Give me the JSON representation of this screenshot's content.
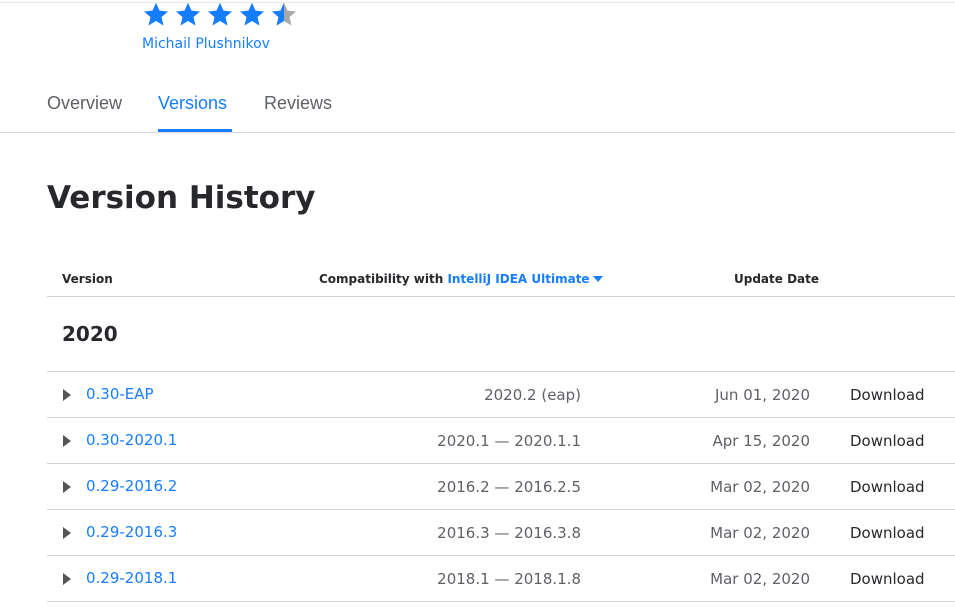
{
  "plugin": {
    "rating": 4.5,
    "rating_max": 5,
    "author": "Michail Plushnikov"
  },
  "tabs": [
    {
      "label": "Overview",
      "active": false
    },
    {
      "label": "Versions",
      "active": true
    },
    {
      "label": "Reviews",
      "active": false
    }
  ],
  "page_title": "Version History",
  "table": {
    "headers": {
      "version": "Version",
      "compat_prefix": "Compatibility with",
      "compat_product": "IntelliJ IDEA Ultimate",
      "update_date": "Update Date"
    },
    "group_year": "2020",
    "rows": [
      {
        "version": "0.30-EAP",
        "compat": "2020.2 (eap)",
        "date": "Jun 01, 2020",
        "action": "Download"
      },
      {
        "version": "0.30-2020.1",
        "compat": "2020.1 — 2020.1.1",
        "date": "Apr 15, 2020",
        "action": "Download"
      },
      {
        "version": "0.29-2016.2",
        "compat": "2016.2 — 2016.2.5",
        "date": "Mar 02, 2020",
        "action": "Download"
      },
      {
        "version": "0.29-2016.3",
        "compat": "2016.3 — 2016.3.8",
        "date": "Mar 02, 2020",
        "action": "Download"
      },
      {
        "version": "0.29-2018.1",
        "compat": "2018.1 — 2018.1.8",
        "date": "Mar 02, 2020",
        "action": "Download"
      }
    ]
  },
  "colors": {
    "accent": "#167dff",
    "text": "#27282c",
    "muted": "#5e6166",
    "star_empty": "#a8a8a8"
  },
  "icons": {
    "star": "star-icon",
    "expand": "expand-triangle-icon",
    "dropdown": "caret-down-icon"
  }
}
